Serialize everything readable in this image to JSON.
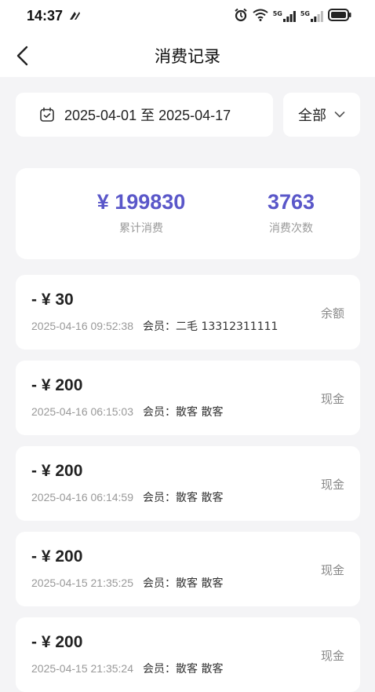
{
  "status_bar": {
    "time": "14:37",
    "signal1": "5G",
    "signal2": "5G"
  },
  "nav": {
    "title": "消费记录"
  },
  "filters": {
    "date_range": "2025-04-01 至 2025-04-17",
    "type_label": "全部"
  },
  "summary": {
    "total_amount": "¥ 199830",
    "total_label": "累计消费",
    "count": "3763",
    "count_label": "消费次数"
  },
  "colors": {
    "accent": "#5a57c9"
  },
  "records": [
    {
      "amount": "- ¥ 30",
      "time": "2025-04-16 09:52:38",
      "member": "会员：二毛 13312311111",
      "pay_type": "余额"
    },
    {
      "amount": "- ¥ 200",
      "time": "2025-04-16 06:15:03",
      "member": "会员：散客 散客",
      "pay_type": "现金"
    },
    {
      "amount": "- ¥ 200",
      "time": "2025-04-16 06:14:59",
      "member": "会员：散客 散客",
      "pay_type": "现金"
    },
    {
      "amount": "- ¥ 200",
      "time": "2025-04-15 21:35:25",
      "member": "会员：散客 散客",
      "pay_type": "现金"
    },
    {
      "amount": "- ¥ 200",
      "time": "2025-04-15 21:35:24",
      "member": "会员：散客 散客",
      "pay_type": "现金"
    }
  ]
}
